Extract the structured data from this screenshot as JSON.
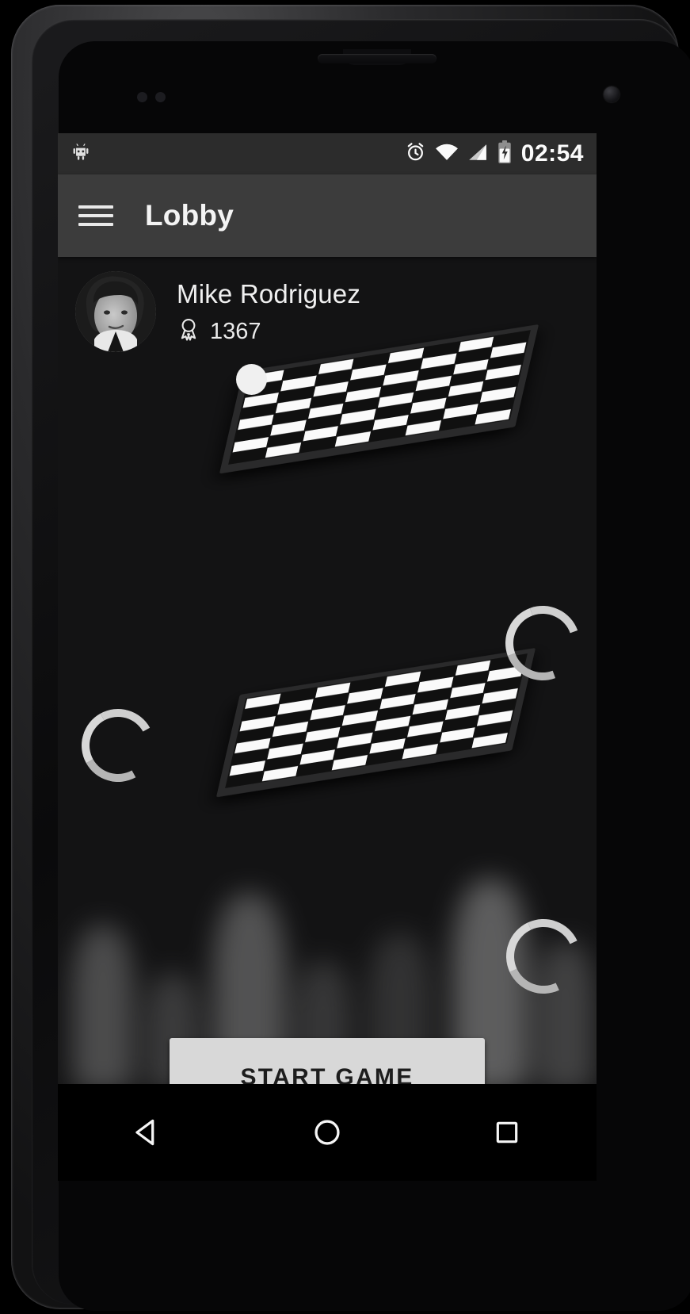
{
  "device": {
    "type": "android-phone",
    "frame_color": "#2a2a2c"
  },
  "status_bar": {
    "time": "02:54",
    "background": "#2c2c2c",
    "notification_icon": "android-robot-icon",
    "icons": [
      {
        "name": "alarm-clock-icon",
        "label": "Alarm set"
      },
      {
        "name": "wifi-icon",
        "label": "Wi-Fi connected"
      },
      {
        "name": "cell-signal-icon",
        "label": "Cellular signal"
      },
      {
        "name": "battery-charging-icon",
        "label": "Battery charging"
      }
    ]
  },
  "app_bar": {
    "title": "Lobby",
    "menu_icon": "hamburger-menu-icon",
    "background": "#3c3c3c",
    "title_color": "#f4f4f4"
  },
  "profile": {
    "player_name": "Mike Rodriguez",
    "rating": "1367",
    "rating_icon": "rosette-award-icon",
    "avatar_icon": "user-avatar-photo",
    "side_indicator": "white-piece-dot"
  },
  "lobby": {
    "boards": [
      {
        "name": "chess-board-top",
        "position": "upper"
      },
      {
        "name": "chess-board-bottom",
        "position": "lower"
      }
    ],
    "spinners": [
      {
        "name": "loading-spinner-right-top"
      },
      {
        "name": "loading-spinner-left"
      },
      {
        "name": "loading-spinner-right-bottom"
      }
    ],
    "background_style": "blurred-chess-pieces"
  },
  "actions": {
    "start_game_label": "START GAME",
    "start_game_bg": "#d8d8d8",
    "start_game_text_color": "#1d1d1d"
  },
  "nav_bar": {
    "background": "#000000",
    "buttons": [
      {
        "name": "nav-back-button",
        "glyph": "back-triangle-icon"
      },
      {
        "name": "nav-home-button",
        "glyph": "home-circle-icon"
      },
      {
        "name": "nav-recents-button",
        "glyph": "recents-square-icon"
      }
    ]
  }
}
